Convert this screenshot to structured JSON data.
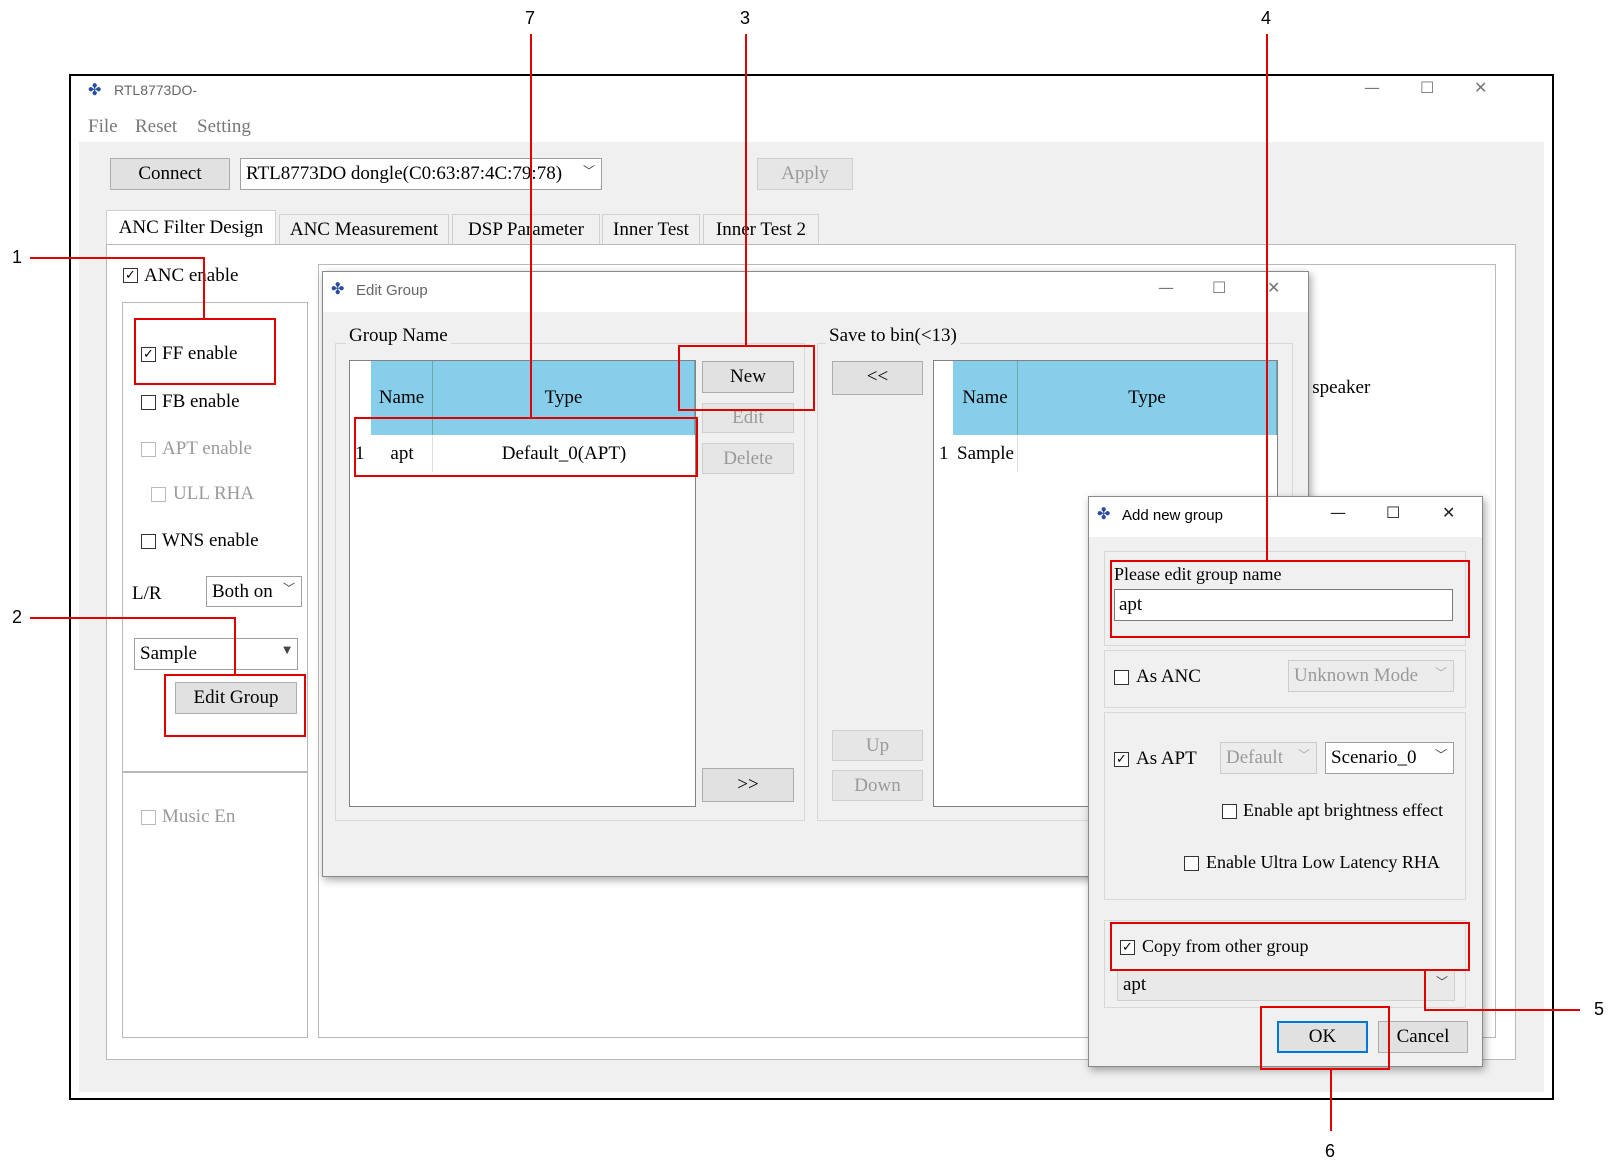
{
  "main_window": {
    "title": "RTL8773DO-",
    "menu": [
      "File",
      "Reset",
      "Setting"
    ],
    "connect_label": "Connect",
    "device_selected": "RTL8773DO dongle(C0:63:87:4C:79:78)",
    "apply_label": "Apply",
    "tabs": [
      "ANC Filter Design",
      "ANC Measurement",
      "DSP Parameter",
      "Inner Test",
      "Inner Test 2"
    ],
    "anc_enable_label": "ANC enable",
    "ff_enable_label": "FF enable",
    "fb_enable_label": "FB enable",
    "apt_enable_label": "APT enable",
    "ull_rha_label": "ULL RHA",
    "wns_enable_label": "WNS enable",
    "lr_label": "L/R",
    "lr_selected": "Both on",
    "group_selected": "Sample",
    "edit_group_label": "Edit Group",
    "music_en_label": "Music En",
    "speaker_fragment": "o speaker",
    "states": {
      "anc_enable": true,
      "ff_enable": true,
      "fb_enable": false,
      "apt_enable": false,
      "ull_rha": false,
      "wns_enable": false,
      "music_en": false
    }
  },
  "edit_group": {
    "title": "Edit Group",
    "group_name_label": "Group Name",
    "save_to_bin_label": "Save to bin(<13)",
    "columns": [
      "Name",
      "Type"
    ],
    "left_rows": [
      {
        "index": "1",
        "name": "apt",
        "type": "Default_0(APT)"
      }
    ],
    "right_rows": [
      {
        "index": "1",
        "name": "Sample",
        "type": ""
      }
    ],
    "new_label": "New",
    "edit_label": "Edit",
    "delete_label": "Delete",
    "move_right_label": ">>",
    "move_left_label": "<<",
    "up_label": "Up",
    "down_label": "Down"
  },
  "add_group": {
    "title": "Add new group",
    "prompt": "Please edit group name",
    "name_value": "apt",
    "as_anc_label": "As ANC",
    "anc_mode_selected": "Unknown Mode",
    "as_apt_label": "As APT",
    "apt_type_selected": "Default",
    "apt_scenario_selected": "Scenario_0",
    "brightness_label": "Enable apt brightness effect",
    "ull_rha_label": "Enable Ultra Low Latency RHA",
    "copy_label": "Copy from other group",
    "copy_source_selected": "apt",
    "ok_label": "OK",
    "cancel_label": "Cancel",
    "states": {
      "as_anc": false,
      "as_apt": true,
      "brightness": false,
      "ull_rha": false,
      "copy": true
    }
  },
  "callouts": [
    "1",
    "2",
    "3",
    "4",
    "5",
    "6",
    "7"
  ],
  "colors": {
    "highlight": "#e00000",
    "table_header": "#87ceeb",
    "window_bg": "#f0f0f0"
  }
}
